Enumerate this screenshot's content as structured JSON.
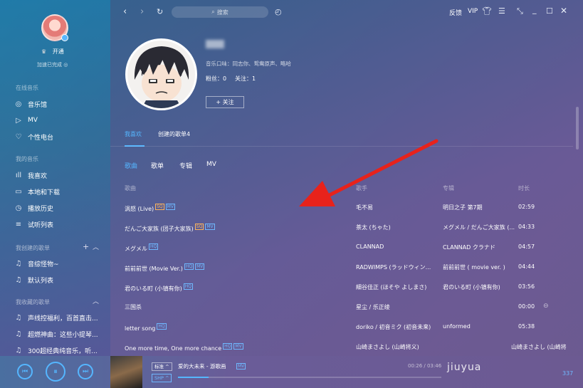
{
  "sidebar": {
    "username": "开通",
    "accel_status": "加速已完成 ◎",
    "sections": {
      "online": "在线音乐",
      "mine": "我的音乐",
      "created": "我创建的歌单",
      "favorited": "我收藏的歌单"
    },
    "online_items": [
      {
        "icon": "music-hall-icon",
        "glyph": "◎",
        "label": "音乐馆"
      },
      {
        "icon": "mv-icon",
        "glyph": "▷",
        "label": "MV"
      },
      {
        "icon": "heart-icon",
        "glyph": "♡",
        "label": "个性电台"
      }
    ],
    "my_items": [
      {
        "icon": "bars-icon",
        "glyph": "ıll",
        "label": "我喜欢"
      },
      {
        "icon": "monitor-icon",
        "glyph": "▭",
        "label": "本地和下载"
      },
      {
        "icon": "clock-icon",
        "glyph": "◷",
        "label": "播放历史"
      },
      {
        "icon": "list-icon",
        "glyph": "≡",
        "label": "试听列表"
      }
    ],
    "created_items": [
      {
        "label": "音综怪物~"
      },
      {
        "label": "默认列表"
      }
    ],
    "favorited_items": [
      {
        "label": "声线控福利，百首直击..."
      },
      {
        "label": "超燃神曲：这些小提琴..."
      },
      {
        "label": "300超经典纯音乐，听..."
      }
    ]
  },
  "toolbar": {
    "search_placeholder": "搜索",
    "feedback": "反馈",
    "vip": "VIP"
  },
  "profile": {
    "taste": "音乐口味：同志你、鸳鸯原声、略哈",
    "fans": "粉丝：0",
    "follow": "关注：1",
    "follow_button": "+ 关注"
  },
  "tabs": {
    "likes": "我喜欢",
    "created": "创建的歌单4"
  },
  "subtabs": [
    "歌曲",
    "歌单",
    "专辑",
    "MV"
  ],
  "table": {
    "headers": {
      "song": "歌曲",
      "artist": "歌手",
      "album": "专辑",
      "duration": "时长"
    },
    "rows": [
      {
        "title": "涡怒 (Live)",
        "tags": [
          "SQ",
          "MV"
        ],
        "artist": "毛不易",
        "album": "明日之子 第7期",
        "duration": "02:59"
      },
      {
        "title": "だんご大家族 (团子大家族)",
        "tags": [
          "SQ",
          "MV"
        ],
        "artist": "茶太 (ちゃた)",
        "album": "メグメル / だんご大家族 (...",
        "duration": "04:33"
      },
      {
        "title": "メグメル",
        "tags": [
          "HQ"
        ],
        "artist": "CLANNAD",
        "album": "CLANNAD クラナド",
        "duration": "04:57"
      },
      {
        "title": "前前前世 (Movie Ver.)",
        "tags": [
          "HQ",
          "MV"
        ],
        "artist": "RADWIMPS (ラッドウィン...",
        "album": "前前前世 ( movie ver. )",
        "duration": "04:44"
      },
      {
        "title": "君のいる町 (小镇有你)",
        "tags": [
          "HQ"
        ],
        "artist": "細谷佳正 (ほそや よしまさ)",
        "album": "君のいる町 (小镇有你)",
        "duration": "03:56"
      },
      {
        "title": "三国杀",
        "tags": [],
        "artist": "星尘 / 乐正绫",
        "album": "",
        "duration": "00:00"
      },
      {
        "title": "letter song",
        "tags": [
          "HQ"
        ],
        "artist": "doriko / 初音ミク (初音未来)",
        "album": "unformed",
        "duration": "05:38"
      },
      {
        "title": "One more time, One more chance",
        "tags": [
          "HQ",
          "MV"
        ],
        "artist": "山崎まさよし (山崎将义)",
        "album": "山崎まさよし (山崎将",
        "duration": ""
      }
    ]
  },
  "player": {
    "quality": "标准 ^",
    "song": "爱的大未来 - 游歌画",
    "tag": "MV",
    "sound": "SHP ^",
    "time": "00:26 / 03:46",
    "count": "337",
    "watermark": "jiuyua",
    "progress": 0.115
  },
  "colors": {
    "accent": "#55b6ff",
    "red_arrow": "#e8221b"
  }
}
